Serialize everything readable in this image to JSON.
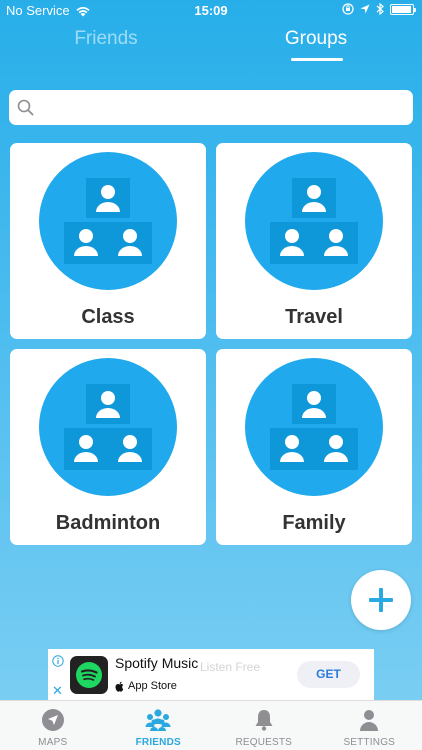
{
  "status_bar": {
    "carrier": "No Service",
    "time": "15:09",
    "battery_level": 0.95
  },
  "top_tabs": [
    {
      "label": "Friends",
      "active": false
    },
    {
      "label": "Groups",
      "active": true
    }
  ],
  "search": {
    "value": "",
    "placeholder": ""
  },
  "groups": [
    {
      "name": "Class"
    },
    {
      "name": "Travel"
    },
    {
      "name": "Badminton"
    },
    {
      "name": "Family"
    }
  ],
  "add_button": {
    "icon": "plus-icon"
  },
  "ad": {
    "title": "Spotify Music",
    "ghost_text": "Listen Free",
    "store_label": "App Store",
    "cta": "GET"
  },
  "tab_bar": [
    {
      "label": "MAPS",
      "icon": "navigation-arrow-icon",
      "active": false
    },
    {
      "label": "FRIENDS",
      "icon": "people-group-icon",
      "active": true
    },
    {
      "label": "REQUESTS",
      "icon": "bell-icon",
      "active": false
    },
    {
      "label": "SETTINGS",
      "icon": "person-icon",
      "active": false
    }
  ],
  "colors": {
    "accent": "#2aa8e0",
    "group_circle": "#20a9ec",
    "background_top": "#27aee9",
    "background_bottom": "#7fd0f3"
  }
}
